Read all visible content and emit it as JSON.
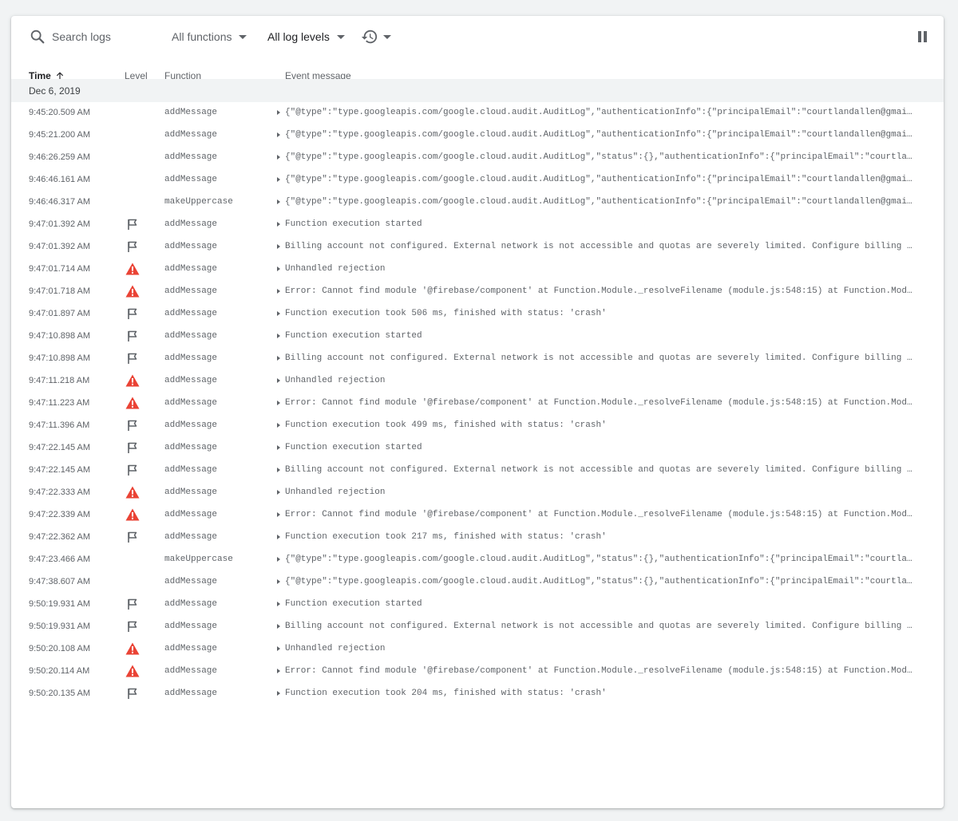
{
  "toolbar": {
    "search_placeholder": "Search logs",
    "functions_filter": "All functions",
    "levels_filter": "All log levels"
  },
  "columns": {
    "time": "Time",
    "level": "Level",
    "function": "Function",
    "message": "Event message"
  },
  "date_group": "Dec 6, 2019",
  "colors": {
    "error": "#ea4335",
    "info_icon": "#5f6368",
    "text_secondary": "#5f6368",
    "date_row_bg": "#f1f3f4"
  },
  "rows": [
    {
      "time": "9:45:20.509 AM",
      "level": "",
      "function": "addMessage",
      "message": "{\"@type\":\"type.googleapis.com/google.cloud.audit.AuditLog\",\"authenticationInfo\":{\"principalEmail\":\"courtlandallen@gmail.com\""
    },
    {
      "time": "9:45:21.200 AM",
      "level": "",
      "function": "addMessage",
      "message": "{\"@type\":\"type.googleapis.com/google.cloud.audit.AuditLog\",\"authenticationInfo\":{\"principalEmail\":\"courtlandallen@gmail.com\""
    },
    {
      "time": "9:46:26.259 AM",
      "level": "",
      "function": "addMessage",
      "message": "{\"@type\":\"type.googleapis.com/google.cloud.audit.AuditLog\",\"status\":{},\"authenticationInfo\":{\"principalEmail\":\"courtlandallen"
    },
    {
      "time": "9:46:46.161 AM",
      "level": "",
      "function": "addMessage",
      "message": "{\"@type\":\"type.googleapis.com/google.cloud.audit.AuditLog\",\"authenticationInfo\":{\"principalEmail\":\"courtlandallen@gmail.com\""
    },
    {
      "time": "9:46:46.317 AM",
      "level": "",
      "function": "makeUppercase",
      "message": "{\"@type\":\"type.googleapis.com/google.cloud.audit.AuditLog\",\"authenticationInfo\":{\"principalEmail\":\"courtlandallen@gmail.com\""
    },
    {
      "time": "9:47:01.392 AM",
      "level": "info",
      "function": "addMessage",
      "message": "Function execution started"
    },
    {
      "time": "9:47:01.392 AM",
      "level": "info",
      "function": "addMessage",
      "message": "Billing account not configured. External network is not accessible and quotas are severely limited. Configure billing account"
    },
    {
      "time": "9:47:01.714 AM",
      "level": "error",
      "function": "addMessage",
      "message": "Unhandled rejection"
    },
    {
      "time": "9:47:01.718 AM",
      "level": "error",
      "function": "addMessage",
      "message": "Error: Cannot find module '@firebase/component' at Function.Module._resolveFilename (module.js:548:15) at Function.Module._load"
    },
    {
      "time": "9:47:01.897 AM",
      "level": "info",
      "function": "addMessage",
      "message": "Function execution took 506 ms, finished with status: 'crash'"
    },
    {
      "time": "9:47:10.898 AM",
      "level": "info",
      "function": "addMessage",
      "message": "Function execution started"
    },
    {
      "time": "9:47:10.898 AM",
      "level": "info",
      "function": "addMessage",
      "message": "Billing account not configured. External network is not accessible and quotas are severely limited. Configure billing account"
    },
    {
      "time": "9:47:11.218 AM",
      "level": "error",
      "function": "addMessage",
      "message": "Unhandled rejection"
    },
    {
      "time": "9:47:11.223 AM",
      "level": "error",
      "function": "addMessage",
      "message": "Error: Cannot find module '@firebase/component' at Function.Module._resolveFilename (module.js:548:15) at Function.Module._load"
    },
    {
      "time": "9:47:11.396 AM",
      "level": "info",
      "function": "addMessage",
      "message": "Function execution took 499 ms, finished with status: 'crash'"
    },
    {
      "time": "9:47:22.145 AM",
      "level": "info",
      "function": "addMessage",
      "message": "Function execution started"
    },
    {
      "time": "9:47:22.145 AM",
      "level": "info",
      "function": "addMessage",
      "message": "Billing account not configured. External network is not accessible and quotas are severely limited. Configure billing account"
    },
    {
      "time": "9:47:22.333 AM",
      "level": "error",
      "function": "addMessage",
      "message": "Unhandled rejection"
    },
    {
      "time": "9:47:22.339 AM",
      "level": "error",
      "function": "addMessage",
      "message": "Error: Cannot find module '@firebase/component' at Function.Module._resolveFilename (module.js:548:15) at Function.Module._load"
    },
    {
      "time": "9:47:22.362 AM",
      "level": "info",
      "function": "addMessage",
      "message": "Function execution took 217 ms, finished with status: 'crash'"
    },
    {
      "time": "9:47:23.466 AM",
      "level": "",
      "function": "makeUppercase",
      "message": "{\"@type\":\"type.googleapis.com/google.cloud.audit.AuditLog\",\"status\":{},\"authenticationInfo\":{\"principalEmail\":\"courtlandallen"
    },
    {
      "time": "9:47:38.607 AM",
      "level": "",
      "function": "addMessage",
      "message": "{\"@type\":\"type.googleapis.com/google.cloud.audit.AuditLog\",\"status\":{},\"authenticationInfo\":{\"principalEmail\":\"courtlandallen"
    },
    {
      "time": "9:50:19.931 AM",
      "level": "info",
      "function": "addMessage",
      "message": "Function execution started"
    },
    {
      "time": "9:50:19.931 AM",
      "level": "info",
      "function": "addMessage",
      "message": "Billing account not configured. External network is not accessible and quotas are severely limited. Configure billing account"
    },
    {
      "time": "9:50:20.108 AM",
      "level": "error",
      "function": "addMessage",
      "message": "Unhandled rejection"
    },
    {
      "time": "9:50:20.114 AM",
      "level": "error",
      "function": "addMessage",
      "message": "Error: Cannot find module '@firebase/component' at Function.Module._resolveFilename (module.js:548:15) at Function.Module._load"
    },
    {
      "time": "9:50:20.135 AM",
      "level": "info",
      "function": "addMessage",
      "message": "Function execution took 204 ms, finished with status: 'crash'"
    }
  ]
}
